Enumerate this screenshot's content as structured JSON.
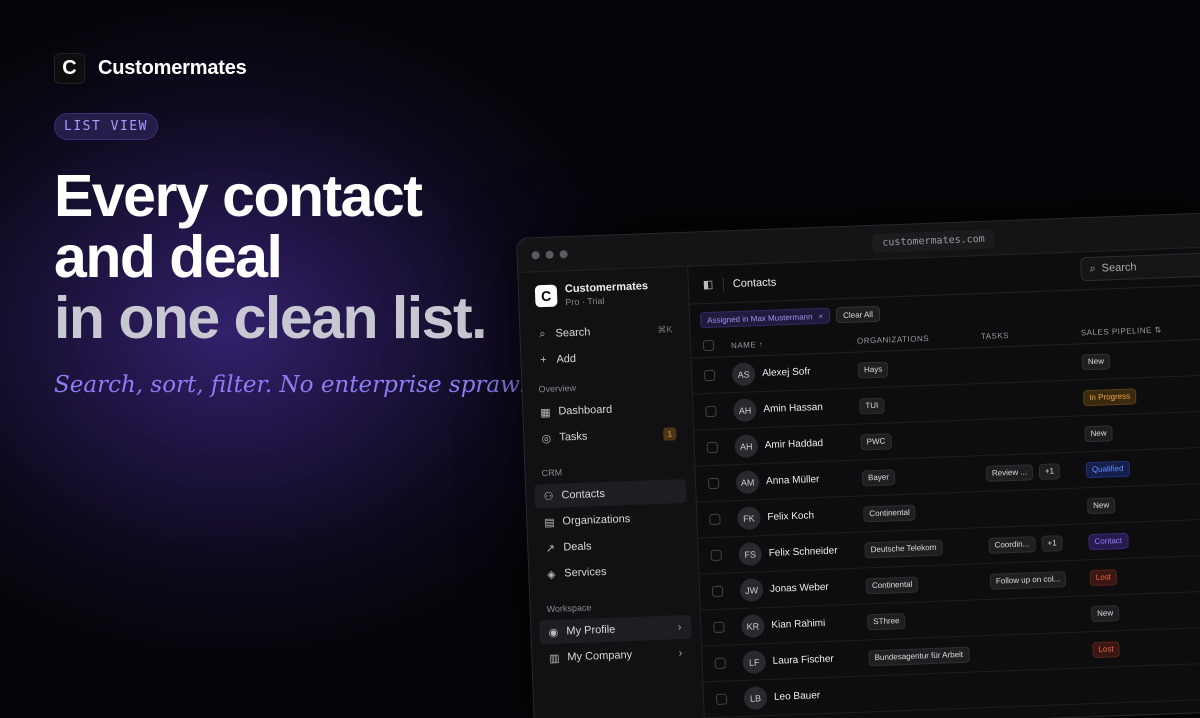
{
  "brand": {
    "logo_letter": "C",
    "name": "Customermates"
  },
  "pill": "LIST VIEW",
  "headline": [
    "Every contact",
    "and deal",
    "in one clean list."
  ],
  "tagline": "Search, sort, filter. No enterprise sprawl.",
  "window": {
    "url": "customermates.com"
  },
  "sidebar": {
    "workspace": {
      "logo_letter": "C",
      "name": "Customermates",
      "plan": "Pro · Trial"
    },
    "top": [
      {
        "label": "Search",
        "icon": "search-icon",
        "shortcut": "⌘K"
      },
      {
        "label": "Add",
        "icon": "plus-icon"
      }
    ],
    "overview_label": "Overview",
    "overview": [
      {
        "label": "Dashboard",
        "icon": "grid-icon"
      },
      {
        "label": "Tasks",
        "icon": "check-circle-icon",
        "badge": "1"
      }
    ],
    "crm_label": "CRM",
    "crm": [
      {
        "label": "Contacts",
        "icon": "users-icon",
        "active": true
      },
      {
        "label": "Organizations",
        "icon": "building-icon"
      },
      {
        "label": "Deals",
        "icon": "trend-icon"
      },
      {
        "label": "Services",
        "icon": "box-icon"
      }
    ],
    "workspace_label": "Workspace",
    "workspace_items": [
      {
        "label": "My Profile",
        "icon": "user-circle-icon"
      },
      {
        "label": "My Company",
        "icon": "building-small-icon"
      }
    ]
  },
  "main": {
    "title": "Contacts",
    "search_placeholder": "Search",
    "filter_chip": "Assigned in Max Mustermann",
    "filter_chip_close": "×",
    "clear_all": "Clear All",
    "columns": {
      "name": "NAME ↑",
      "organizations": "ORGANIZATIONS",
      "tasks": "TASKS",
      "pipeline": "SALES PIPELINE ⇅"
    },
    "rows": [
      {
        "initials": "AS",
        "name": "Alexej Sofr",
        "org": "Hays",
        "task": "",
        "more": "",
        "stage": "New"
      },
      {
        "initials": "AH",
        "name": "Amin Hassan",
        "org": "TUI",
        "task": "",
        "more": "",
        "stage": "In Progress"
      },
      {
        "initials": "AH",
        "name": "Amir Haddad",
        "org": "PWC",
        "task": "",
        "more": "",
        "stage": "New"
      },
      {
        "initials": "AM",
        "name": "Anna Müller",
        "org": "Bayer",
        "task": "Review ...",
        "more": "+1",
        "stage": "Qualified"
      },
      {
        "initials": "FK",
        "name": "Felix Koch",
        "org": "Continental",
        "task": "",
        "more": "",
        "stage": "New"
      },
      {
        "initials": "FS",
        "name": "Felix Schneider",
        "org": "Deutsche Telekom",
        "task": "Coordin...",
        "more": "+1",
        "stage": "Contact"
      },
      {
        "initials": "JW",
        "name": "Jonas Weber",
        "org": "Continental",
        "task": "Follow up on col...",
        "more": "",
        "stage": "Lost"
      },
      {
        "initials": "KR",
        "name": "Kian Rahimi",
        "org": "SThree",
        "task": "",
        "more": "",
        "stage": "New"
      },
      {
        "initials": "LF",
        "name": "Laura Fischer",
        "org": "Bundesagentur für Arbeit",
        "task": "",
        "more": "",
        "stage": "Lost"
      },
      {
        "initials": "LB",
        "name": "Leo Bauer",
        "org": "",
        "task": "",
        "more": "",
        "stage": ""
      }
    ]
  },
  "stage_colors": {
    "New": {
      "bg": "#1f1f22",
      "fg": "#dddddd",
      "border": "#2e2e32"
    },
    "In Progress": {
      "bg": "#3a2a10",
      "fg": "#f0a63a",
      "border": "#5a4018"
    },
    "Qualified": {
      "bg": "#15204a",
      "fg": "#6b8cff",
      "border": "#223270"
    },
    "Contact": {
      "bg": "#271a4d",
      "fg": "#9b7bff",
      "border": "#3a2a70"
    },
    "Lost": {
      "bg": "#3a1712",
      "fg": "#f06a4a",
      "border": "#5a2418"
    }
  }
}
